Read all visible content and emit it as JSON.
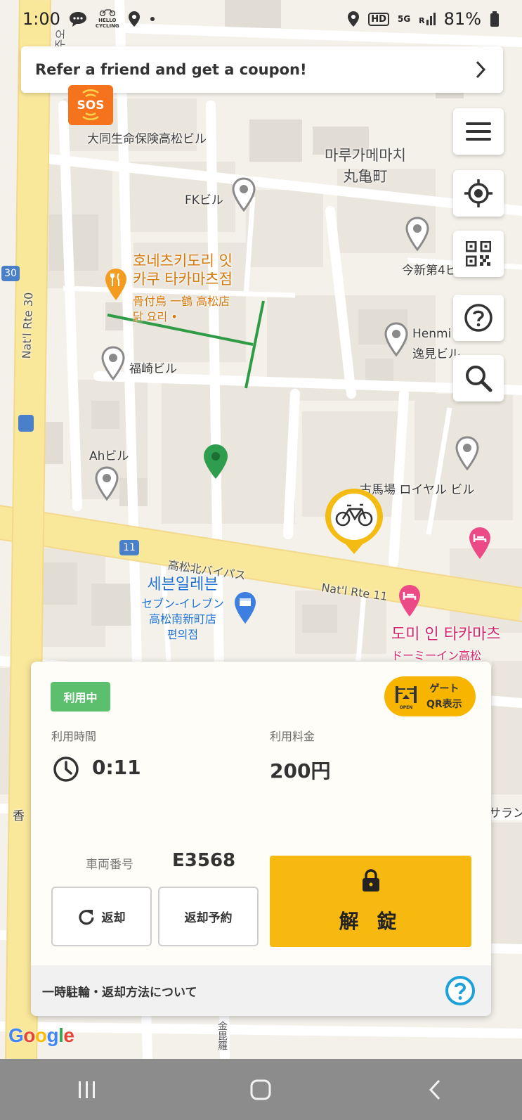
{
  "status_bar": {
    "time": "1:00",
    "hello_cycling_badge": [
      "HELLO",
      "CYCLING"
    ],
    "hd_badge": "HD",
    "network": "5G",
    "roaming": "R",
    "battery": "81%"
  },
  "refer_banner": {
    "text": "Refer a friend and get a coupon!"
  },
  "sos_button": {
    "label": "SOS"
  },
  "side_buttons": [
    "menu-icon",
    "locate-icon",
    "qr-code-icon",
    "help-icon",
    "search-icon"
  ],
  "map": {
    "labels": {
      "daido": "大同生命保険高松ビル",
      "marugame_ko": "마루가메마치",
      "marugame_ja": "丸亀町",
      "fk": "FKビル",
      "imashin": "今新第4ビ",
      "restaurant_ko_1": "호네츠키도리 잇",
      "restaurant_ko_2": "카쿠 타카마츠점",
      "restaurant_ja": "骨付鳥 一鶴 高松店",
      "restaurant_sub": "닭 요리 •",
      "henmi_en": "Henmi",
      "henmi_ja": "逸見ビル",
      "fukuzaki": "福崎ビル",
      "ah": "Ahビル",
      "furubaba": "古馬場 ロイヤル ビル",
      "bypass": "高松北バイパス",
      "rte11": "Nat'l Rte 11",
      "rte30": "Nat'l Rte 30",
      "shield_30": "30",
      "shield_11": "11",
      "seven_ko": "세븐일레븐",
      "seven_ja_1": "セブン-イレブン",
      "seven_ja_2": "高松南新町店",
      "seven_sub": "편의점",
      "dormy_ko": "도미 인 타카마츠",
      "dormy_ja": "ドーミーイン高松",
      "kagawa_partial": "香",
      "saran_partial": "サラン",
      "kotohira_vertical": "金毘羅",
      "top_vertical": "주오",
      "map_logo": "Google"
    }
  },
  "ride_card": {
    "status_badge": "利用中",
    "gate_qr": {
      "line1": "ゲート",
      "line2": "QR表示",
      "icon_caption": "OPEN"
    },
    "usage_time_label": "利用時間",
    "usage_time": "0:11",
    "usage_fee_label": "利用料金",
    "usage_fee": "200円",
    "vehicle_number_label": "車両番号",
    "vehicle_number": "E3568",
    "return_button": "返却",
    "return_reserve_button": "返却予約",
    "unlock_button": "解 錠",
    "help_footer": "一時駐輪・返却方法について"
  },
  "colors": {
    "accent_yellow": "#f7b90f",
    "sos_orange": "#f5731c",
    "status_green": "#5cbf6e",
    "help_blue": "#1ea0d8"
  }
}
